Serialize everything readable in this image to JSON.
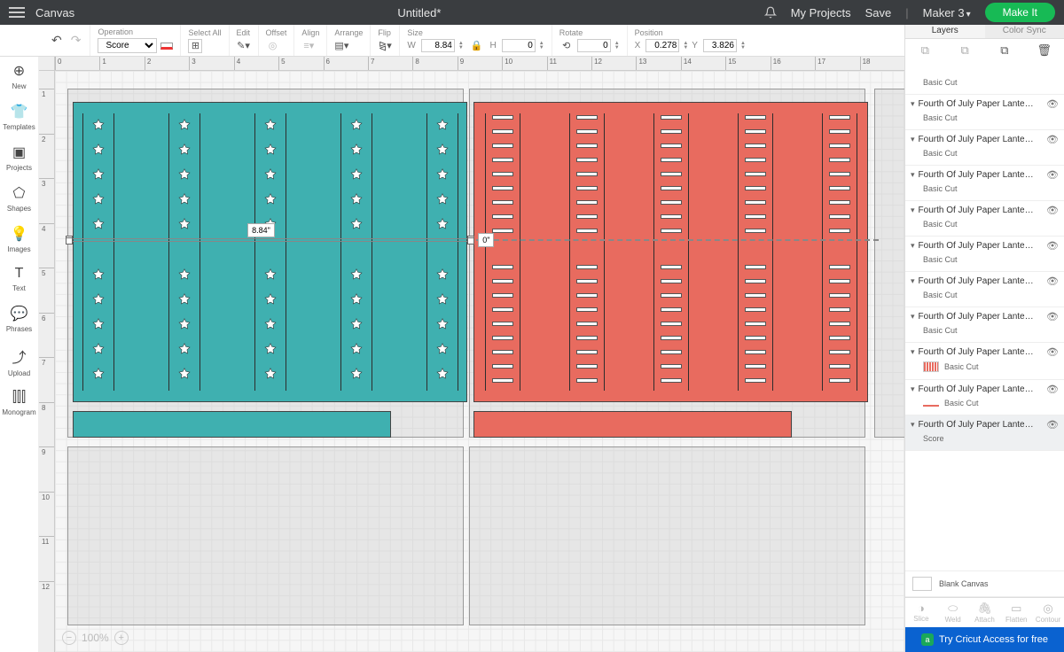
{
  "header": {
    "app": "Canvas",
    "title": "Untitled*",
    "my_projects": "My Projects",
    "save": "Save",
    "machine": "Maker 3",
    "make_it": "Make It"
  },
  "toolbar": {
    "operation": {
      "label": "Operation",
      "value": "Score"
    },
    "select_all": "Select All",
    "edit": "Edit",
    "offset": "Offset",
    "align": "Align",
    "arrange": "Arrange",
    "flip": "Flip",
    "size": {
      "label": "Size",
      "w_label": "W",
      "w": "8.84",
      "h_label": "H",
      "h": "0"
    },
    "rotate": {
      "label": "Rotate",
      "value": "0"
    },
    "position": {
      "label": "Position",
      "x_label": "X",
      "x": "0.278",
      "y_label": "Y",
      "y": "3.826"
    }
  },
  "left_rail": [
    {
      "icon": "⊕",
      "label": "New"
    },
    {
      "icon": "👕",
      "label": "Templates"
    },
    {
      "icon": "▣",
      "label": "Projects"
    },
    {
      "icon": "⬠",
      "label": "Shapes"
    },
    {
      "icon": "💡",
      "label": "Images"
    },
    {
      "icon": "T",
      "label": "Text"
    },
    {
      "icon": "💬",
      "label": "Phrases"
    },
    {
      "icon": "⤴",
      "label": "Upload"
    },
    {
      "icon": "⫿⫿⫿",
      "label": "Monogram"
    }
  ],
  "ruler_h": [
    "0",
    "1",
    "2",
    "3",
    "4",
    "5",
    "6",
    "7",
    "8",
    "9",
    "10",
    "11",
    "12",
    "13",
    "14",
    "15",
    "16",
    "17",
    "18"
  ],
  "ruler_v": [
    "1",
    "2",
    "3",
    "4",
    "5",
    "6",
    "7",
    "8",
    "9",
    "10",
    "11",
    "12"
  ],
  "canvas": {
    "dim1": "8.84\"",
    "dim2": "0\"",
    "zoom": "100%"
  },
  "layers_tabs": {
    "layers": "Layers",
    "colorsync": "Color Sync"
  },
  "layer_actions": [
    {
      "icon": "⧉",
      "label": "Group",
      "enabled": false
    },
    {
      "icon": "⧉",
      "label": "UnGroup",
      "enabled": false
    },
    {
      "icon": "⧉",
      "label": "Duplicate",
      "enabled": true
    },
    {
      "icon": "🗑",
      "label": "Delete",
      "enabled": true
    }
  ],
  "layers": [
    {
      "name": "",
      "sub": "Basic Cut",
      "swatch": "",
      "top_crop": true
    },
    {
      "name": "Fourth Of July Paper Lante…",
      "sub": "Basic Cut",
      "swatch": ""
    },
    {
      "name": "Fourth Of July Paper Lante…",
      "sub": "Basic Cut",
      "swatch": ""
    },
    {
      "name": "Fourth Of July Paper Lante…",
      "sub": "Basic Cut",
      "swatch": ""
    },
    {
      "name": "Fourth Of July Paper Lante…",
      "sub": "Basic Cut",
      "swatch": ""
    },
    {
      "name": "Fourth Of July Paper Lante…",
      "sub": "Basic Cut",
      "swatch": ""
    },
    {
      "name": "Fourth Of July Paper Lante…",
      "sub": "Basic Cut",
      "swatch": ""
    },
    {
      "name": "Fourth Of July Paper Lante…",
      "sub": "Basic Cut",
      "swatch": ""
    },
    {
      "name": "Fourth Of July Paper Lante…",
      "sub": "Basic Cut",
      "swatch": "#e86b5f",
      "swatch_pattern": "stripes"
    },
    {
      "name": "Fourth Of July Paper Lante…",
      "sub": "Basic Cut",
      "swatch": "#e86b5f",
      "swatch_pattern": "line"
    },
    {
      "name": "Fourth Of July Paper Lante…",
      "sub": "Score",
      "swatch": "",
      "selected": true
    }
  ],
  "blank_canvas": "Blank Canvas",
  "layer_ops": [
    {
      "icon": "◑",
      "label": "Slice"
    },
    {
      "icon": "⬭",
      "label": "Weld"
    },
    {
      "icon": "🖇",
      "label": "Attach"
    },
    {
      "icon": "▭",
      "label": "Flatten"
    },
    {
      "icon": "◎",
      "label": "Contour"
    }
  ],
  "cta": "Try Cricut Access for free"
}
